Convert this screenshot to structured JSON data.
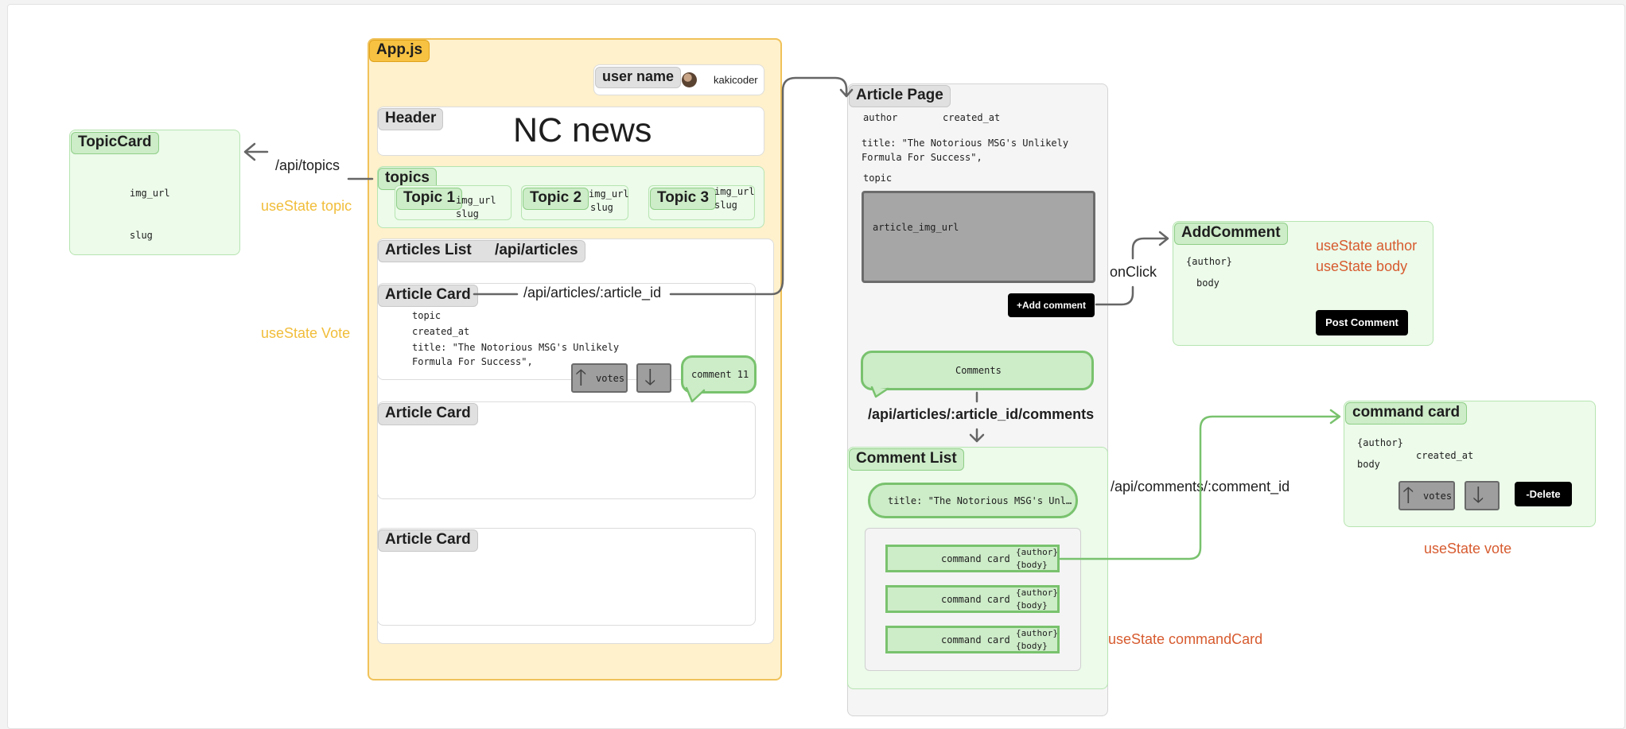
{
  "topic_card": {
    "title": "TopicCard",
    "field1": "img_url",
    "field2": "slug"
  },
  "api_topics": "/api/topics",
  "use_state_topic": "useState topic",
  "use_state_vote_left": "useState Vote",
  "app": {
    "title": "App.js",
    "user_name_label": "user name",
    "username": "kakicoder",
    "header_tag": "Header",
    "header_title": "NC news",
    "topics_tag": "topics",
    "topics": [
      {
        "name": "Topic 1",
        "img": "img_url",
        "slug": "slug"
      },
      {
        "name": "Topic 2",
        "img": "img_url",
        "slug": "slug"
      },
      {
        "name": "Topic 3",
        "img": "img_url",
        "slug": "slug"
      }
    ],
    "articles_list_label": "Articles List",
    "articles_api": "/api/articles",
    "article_card_label": "Article Card",
    "article_api": "/api/articles/:article_id",
    "card_topic": "topic",
    "card_created": "created_at",
    "card_title_line1": "title: \"The Notorious MSG's Unlikely",
    "card_title_line2": "Formula For Success\",",
    "votes_label": "votes",
    "comment_bubble": "comment 11"
  },
  "article_page": {
    "title": "Article Page",
    "author": "author",
    "created_at": "created_at",
    "title_line1": "title: \"The Notorious MSG's Unlikely",
    "title_line2": "Formula For Success\",",
    "topic": "topic",
    "img": "article_img_url",
    "add_comment_btn": "+Add comment",
    "comments_bubble": "Comments",
    "comments_api": "/api/articles/:article_id/comments",
    "comment_list_title": "Comment List",
    "comment_title_pill": "title: \"The Notorious MSG's Unl…",
    "command_card_label": "command card",
    "author_field": "{author}",
    "body_field": "{body}",
    "use_state_command_card": "useState commandCard"
  },
  "on_click": "onClick",
  "add_comment": {
    "title": "AddComment",
    "author": "{author}",
    "body": "body",
    "use_state_author": "useState author",
    "use_state_body": "useState body",
    "post_btn": "Post Comment"
  },
  "comments_api_id": "/api/comments/:comment_id",
  "command_card": {
    "title": "command card",
    "author": "{author}",
    "created_at": "created_at",
    "body": "body",
    "votes_label": "votes",
    "delete_btn": "-Delete",
    "use_state_vote": "useState vote"
  }
}
